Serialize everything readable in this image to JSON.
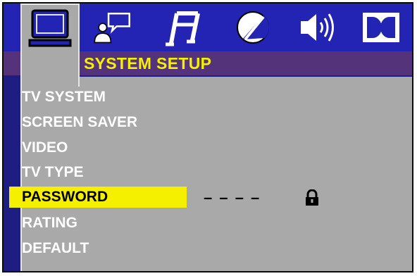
{
  "menu": {
    "title": "SYSTEM SETUP",
    "tabs": [
      {
        "name": "system",
        "icon": "tv-monitor-icon",
        "active": true
      },
      {
        "name": "language",
        "icon": "speech-bubble-person-icon",
        "active": false
      },
      {
        "name": "audio",
        "icon": "music-note-icon",
        "active": false
      },
      {
        "name": "video",
        "icon": "color-disc-icon",
        "active": false
      },
      {
        "name": "speaker",
        "icon": "speaker-icon",
        "active": false
      },
      {
        "name": "dolby",
        "icon": "dolby-icon",
        "active": false
      }
    ],
    "items": [
      {
        "label": "TV SYSTEM"
      },
      {
        "label": "SCREEN SAVER"
      },
      {
        "label": "VIDEO"
      },
      {
        "label": "TV TYPE"
      },
      {
        "label": "PASSWORD",
        "selected": true
      },
      {
        "label": "RATING"
      },
      {
        "label": "DEFAULT"
      }
    ],
    "password": {
      "value": "– – – –",
      "icon": "lock-icon"
    }
  },
  "colors": {
    "background": "#1e1e82",
    "tab_bar": "#2323b4",
    "panel": "#a9a9a9",
    "header_strip": "#55337a",
    "title": "#f5f000",
    "selected": "#f5f000"
  }
}
